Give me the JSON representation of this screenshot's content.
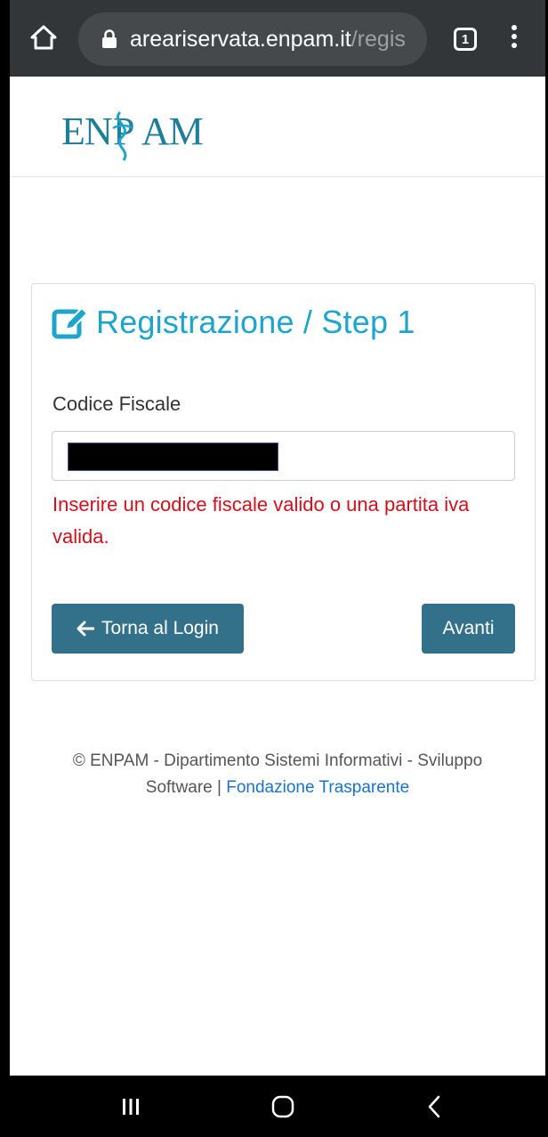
{
  "browser": {
    "url_host": "areariservata.enpam.it",
    "url_path": "/regis",
    "tab_count": "1"
  },
  "header": {
    "logo_text": "ENPAM"
  },
  "card": {
    "title": "Registrazione / Step 1",
    "field_label": "Codice Fiscale",
    "error_message": "Inserire un codice fiscale valido o una partita iva valida.",
    "back_button_label": "Torna al Login",
    "next_button_label": "Avanti"
  },
  "footer": {
    "copyright_text": "© ENPAM - Dipartimento Sistemi Informativi - Sviluppo",
    "copyright_text_2": "Software | ",
    "link_label": "Fondazione Trasparente"
  },
  "colors": {
    "accent": "#1fa4cd",
    "button": "#337089",
    "error": "#d0101b",
    "link": "#1a73c8"
  },
  "icons": {
    "home": "home-icon",
    "lock": "lock-icon",
    "tabs": "tabs-icon",
    "menu": "kebab-menu-icon",
    "edit": "edit-icon",
    "arrow": "arrow-left-icon"
  }
}
